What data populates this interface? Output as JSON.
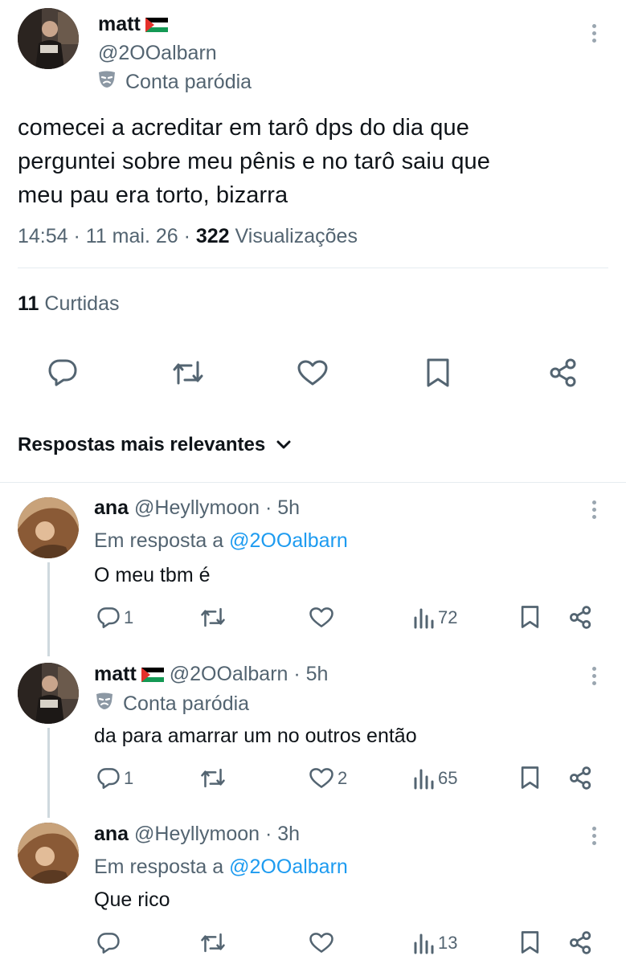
{
  "post": {
    "author_name": "matt",
    "author_handle": "@2OOalbarn",
    "parody_label": "Conta paródia",
    "text_line1": "comecei a acreditar em tarô dps do dia que",
    "text_line2": "perguntei sobre meu pênis e no tarô saiu que",
    "text_line3": "meu pau era torto, bizarra",
    "time": "14:54 · 11 mai. 26 · ",
    "views_count": "322",
    "views_label": " Visualizações",
    "likes_count": "11",
    "likes_label": " Curtidas"
  },
  "sort_label": "Respostas mais relevantes",
  "replies": [
    {
      "name": "ana",
      "handle": "@Heyllymoon · 5h",
      "reply_to_label": "Em resposta a ",
      "reply_to_handle": "@2OOalbarn",
      "text": "O meu tbm é",
      "replies": "1",
      "likes": "",
      "views": "72"
    },
    {
      "name": "matt",
      "handle": "@2OOalbarn · 5h",
      "parody_label": "Conta paródia",
      "text": "da para amarrar um no outros então",
      "replies": "1",
      "likes": "2",
      "views": "65"
    },
    {
      "name": "ana",
      "handle": "@Heyllymoon · 3h",
      "reply_to_label": "Em resposta a ",
      "reply_to_handle": "@2OOalbarn",
      "text": "Que rico",
      "replies": "",
      "likes": "",
      "views": "13"
    }
  ],
  "icons": {
    "reply": "reply-icon",
    "retweet": "retweet-icon",
    "like": "heart-icon",
    "bookmark": "bookmark-icon",
    "share": "share-icon",
    "views": "views-icon",
    "more": "more-icon",
    "parody": "parody-mask-icon",
    "flag": "palestine-flag-icon"
  },
  "colors": {
    "text": "#0f1419",
    "secondary": "#536471",
    "link": "#1d9bf0",
    "divider": "#e6ecf0"
  }
}
